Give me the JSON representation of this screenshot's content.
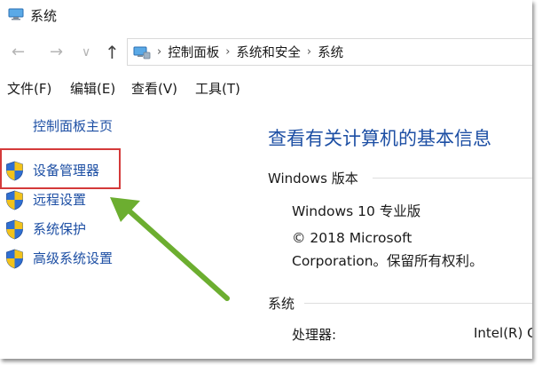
{
  "window": {
    "title": "系统"
  },
  "navigation": {
    "back_glyph": "←",
    "forward_glyph": "→",
    "recent_glyph": "∨",
    "up_glyph": "↑",
    "separator_glyph": "›",
    "breadcrumbs": [
      "控制面板",
      "系统和安全",
      "系统"
    ]
  },
  "menu": [
    "文件(F)",
    "编辑(E)",
    "查看(V)",
    "工具(T)"
  ],
  "sidebar": {
    "home_link": "控制面板主页",
    "items": [
      {
        "label": "设备管理器",
        "icon": "uac-shield-icon"
      },
      {
        "label": "远程设置",
        "icon": "uac-shield-icon"
      },
      {
        "label": "系统保护",
        "icon": "uac-shield-icon"
      },
      {
        "label": "高级系统设置",
        "icon": "uac-shield-icon"
      }
    ],
    "highlighted_item": "设备管理器"
  },
  "main": {
    "heading": "查看有关计算机的基本信息",
    "windows_edition": {
      "section_label": "Windows 版本",
      "edition": "Windows 10 专业版",
      "copyright_line1": "© 2018 Microsoft",
      "copyright_line2": "Corporation。保留所有权利。"
    },
    "system": {
      "section_label": "系统",
      "processor_label": "处理器:",
      "processor_value": "Intel(R) C"
    }
  },
  "colors": {
    "link": "#1d4fa4",
    "highlight_border": "#d43a3a",
    "arrow": "#6cae30",
    "shield_blue": "#2f6fd1",
    "shield_yellow": "#f2c21b"
  }
}
